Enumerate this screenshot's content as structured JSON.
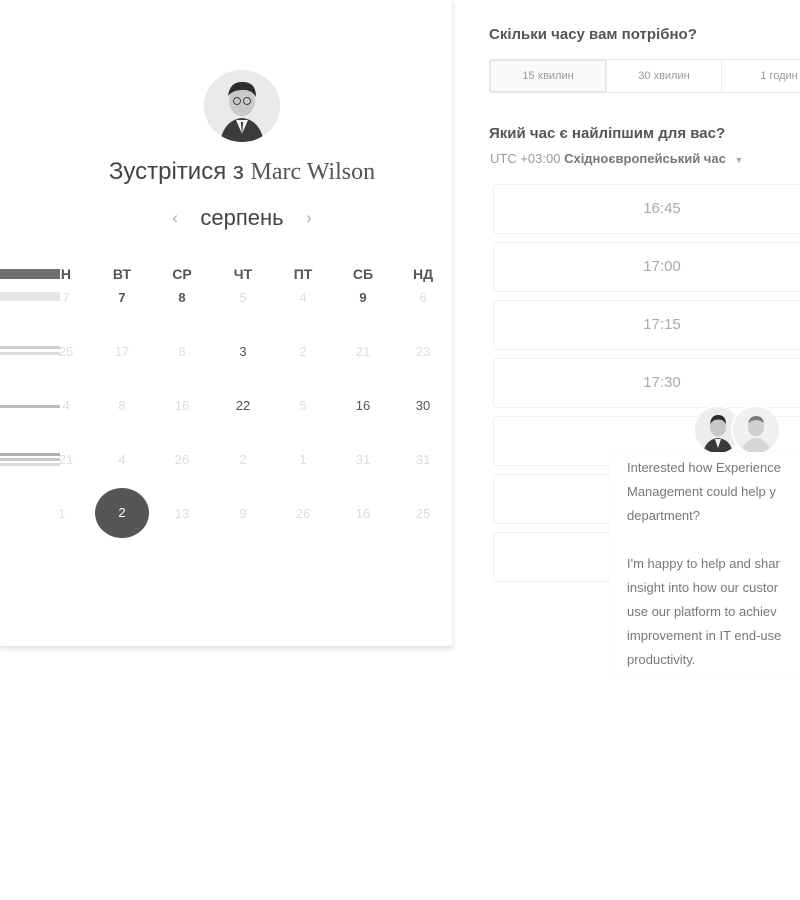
{
  "booking": {
    "title_prefix": "Зустрітися з ",
    "host_name": "Marc Wilson",
    "month": "серпень",
    "prev_arrow": "‹",
    "next_arrow": "›",
    "weekdays_visible": [
      "ВТ",
      "СР",
      "ЧТ",
      "ПТ",
      "СБ",
      "НД"
    ],
    "weekday_partial": "Н",
    "calendar_rows": [
      [
        "7",
        "7",
        "8",
        "5",
        "4",
        "9",
        "6"
      ],
      [
        "25",
        "17",
        "8",
        "3",
        "2",
        "21",
        "23"
      ],
      [
        "4",
        "8",
        "16",
        "22",
        "5",
        "16",
        "30"
      ],
      [
        "21",
        "4",
        "26",
        "2",
        "1",
        "31",
        "31"
      ],
      [
        "1",
        "2",
        "13",
        "9",
        "26",
        "16",
        "25"
      ]
    ],
    "selected_day": "2"
  },
  "duration": {
    "title": "Скільки часу вам потрібно?",
    "options": [
      "15 хвилин",
      "30 хвилин",
      "1 годин"
    ],
    "selected": "15 хвилин"
  },
  "time": {
    "title": "Який час є найліпшим для вас?",
    "timezone_offset": "UTC +03:00",
    "timezone_name": "Східноєвропейський час",
    "slots": [
      "16:45",
      "17:00",
      "17:15",
      "17:30"
    ]
  },
  "chat": {
    "message_1": "Interested how Experience\nManagement could help y\ndepartment?",
    "message_2": "I'm happy to help and shar\ninsight into how our custor\nuse our platform to achiev\nimprovement in IT end-use\nproductivity."
  },
  "colors": {
    "selected_day_bg": "#565656",
    "muted_text": "#dddddd",
    "available_text": "#555555"
  }
}
